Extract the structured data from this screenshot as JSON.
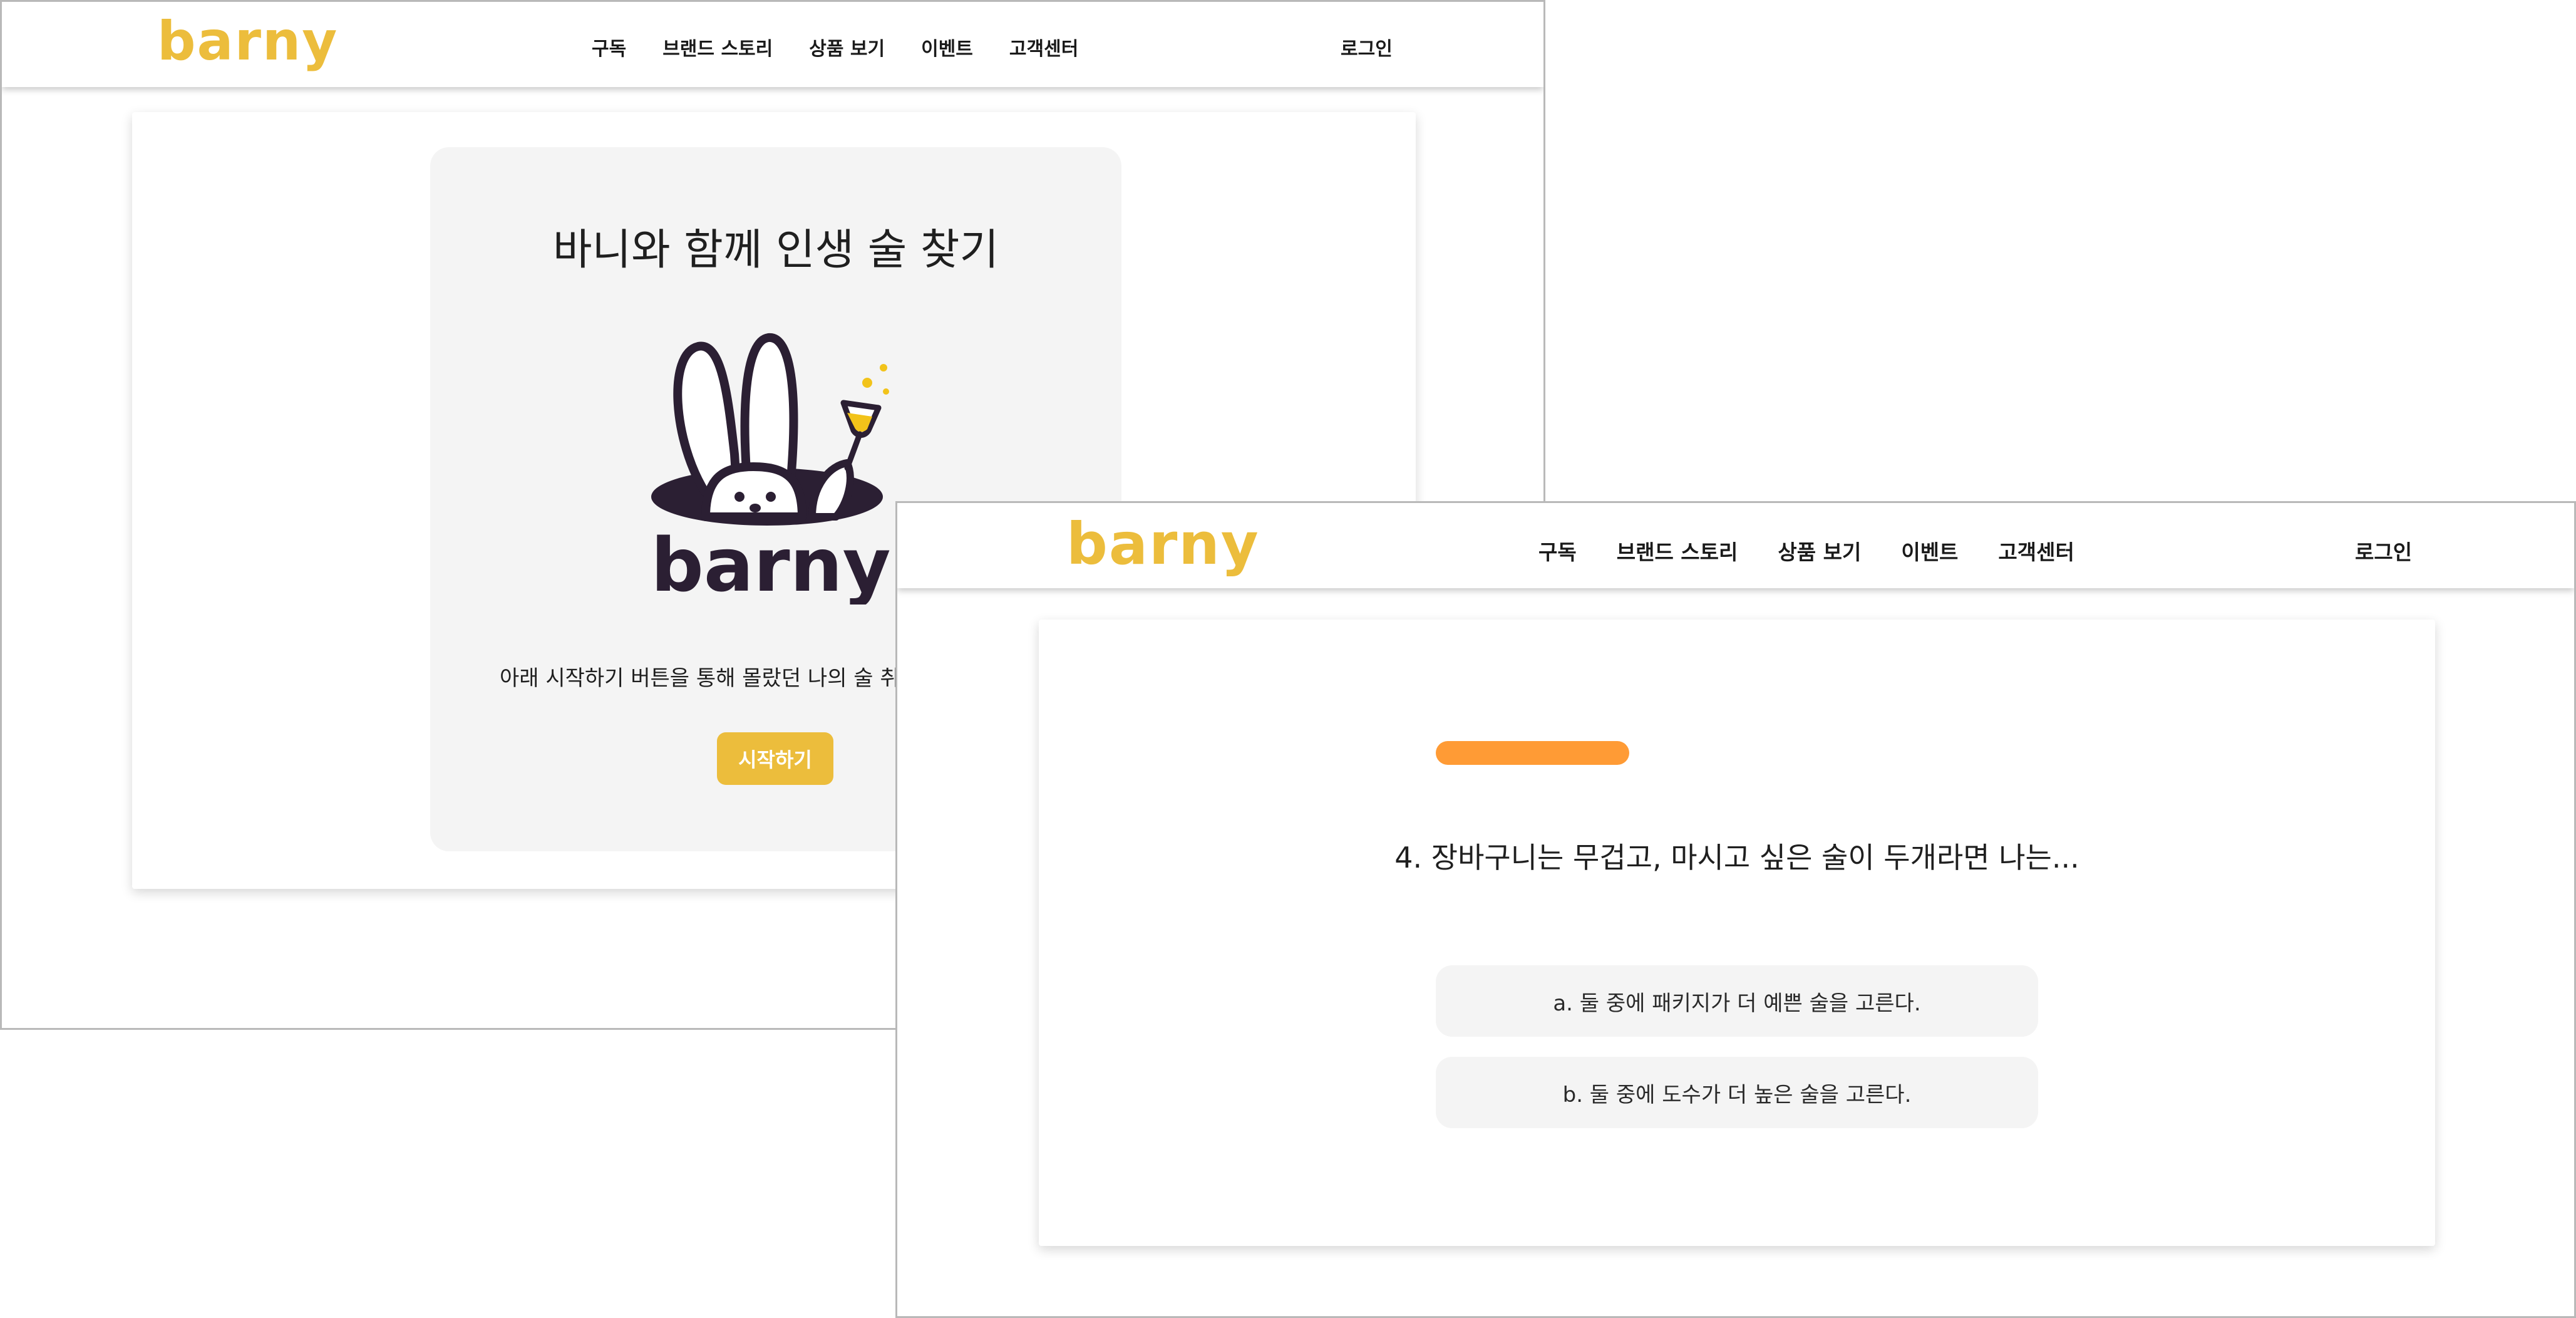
{
  "nav": {
    "logo": "barny",
    "items": [
      "구독",
      "브랜드 스토리",
      "상품 보기",
      "이벤트",
      "고객센터"
    ],
    "login": "로그인"
  },
  "intro": {
    "title": "바니와 함께 인생 술 찾기",
    "mascot_wordmark": "barny",
    "description": "아래 시작하기 버튼을 통해 몰랐던 나의 술 취향을 찾아보세요!",
    "start_button": "시작하기"
  },
  "quiz": {
    "progress_percent": 32,
    "question": "4. 장바구니는 무겁고, 마시고 싶은 술이 두개라면 나는...",
    "options": [
      "a. 둘 중에 패키지가 더 예쁜 술을 고른다.",
      "b. 둘 중에 도수가 더 높은 술을 고른다."
    ]
  },
  "colors": {
    "brand": "#ecbd3c",
    "progress": "#ff9b35",
    "mascot": "#2b1f33",
    "panel": "#f4f4f4"
  }
}
